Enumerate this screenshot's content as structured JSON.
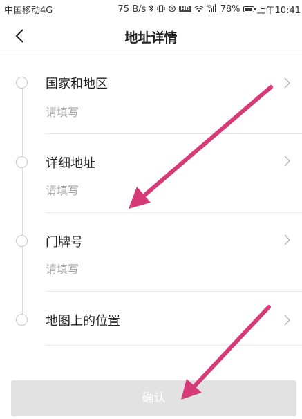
{
  "status_bar": {
    "carrier": "中国移动4G",
    "speed": "75 B/s",
    "battery": "78%",
    "time": "上午10:41",
    "icons": [
      "bluetooth-icon",
      "vibrate-icon",
      "alarm-icon",
      "hd-icon",
      "wifi-icon",
      "signal-icon",
      "battery-icon"
    ],
    "signal_label": "4G",
    "hd_label": "HD"
  },
  "header": {
    "title": "地址详情",
    "back_icon": "chevron-left-icon"
  },
  "rows": [
    {
      "label": "国家和地区",
      "value": "请填写"
    },
    {
      "label": "详细地址",
      "value": "请填写"
    },
    {
      "label": "门牌号",
      "value": "请填写"
    },
    {
      "label": "地图上的位置",
      "value": ""
    }
  ],
  "confirm_label": "确认",
  "colors": {
    "annotation_arrow": "#d63b78",
    "button_bg": "#e2e2e2",
    "placeholder": "#a6a6a6",
    "divider": "#e8e8e8"
  }
}
